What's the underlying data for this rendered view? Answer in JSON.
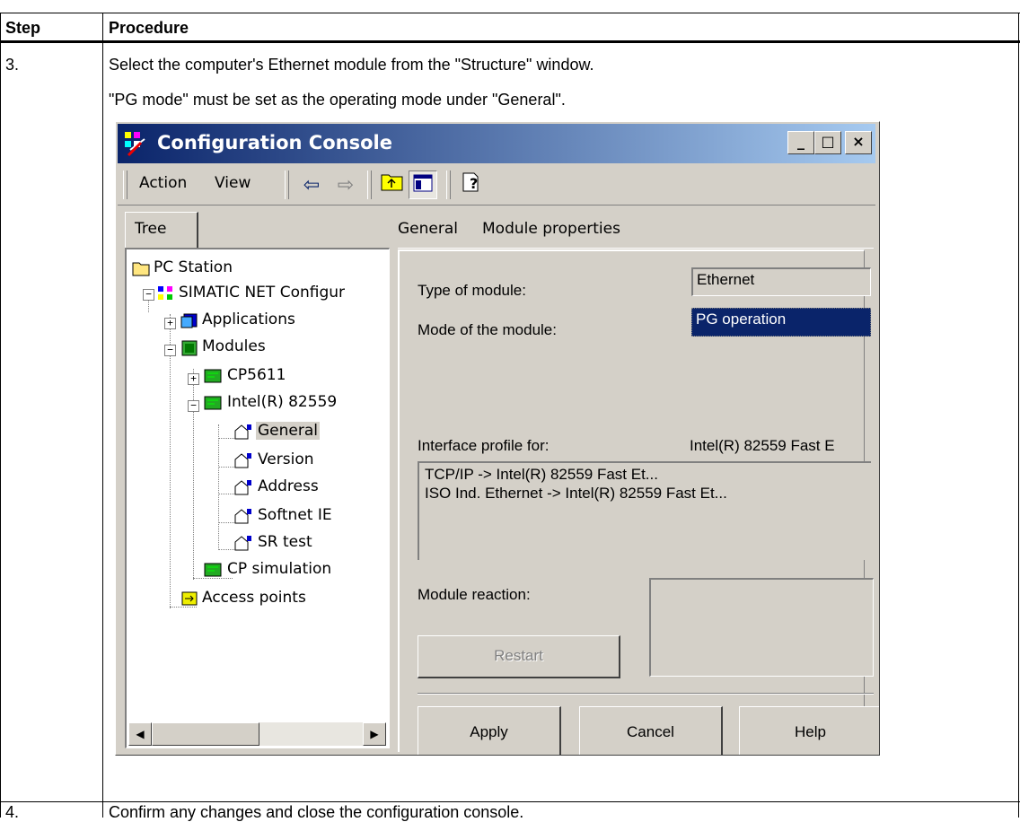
{
  "table": {
    "header_step": "Step",
    "header_procedure": "Procedure",
    "row3_step": "3.",
    "row3_line1": "Select the computer's Ethernet module from the \"Structure\" window.",
    "row3_line2": "\"PG mode\" must be set as the operating mode under \"General\".",
    "row4_step": "4.",
    "row4_text": "Confirm any changes and close the configuration console."
  },
  "window": {
    "title": "Configuration Console",
    "minimize": "_",
    "maximize": "□",
    "close": "×",
    "menu": {
      "action": "Action",
      "view": "View"
    },
    "tree_tab": "Tree",
    "tree": [
      {
        "label": "PC Station",
        "icon": "folder-icon"
      },
      {
        "label": "SIMATIC NET Configur",
        "icon": "network-config-icon"
      },
      {
        "label": "Applications",
        "icon": "applications-icon"
      },
      {
        "label": "Modules",
        "icon": "modules-icon"
      },
      {
        "label": "CP5611",
        "icon": "module-card-icon"
      },
      {
        "label": "Intel(R) 82559",
        "icon": "module-card-icon"
      },
      {
        "label": "General",
        "icon": "properties-icon",
        "selected": true
      },
      {
        "label": "Version",
        "icon": "properties-icon"
      },
      {
        "label": "Address",
        "icon": "properties-icon"
      },
      {
        "label": "Softnet IE",
        "icon": "properties-icon"
      },
      {
        "label": "SR test",
        "icon": "properties-icon"
      },
      {
        "label": "CP simulation",
        "icon": "module-card-icon"
      },
      {
        "label": "Access points",
        "icon": "access-points-icon"
      }
    ],
    "right_tabs": {
      "general": "General",
      "module_properties": "Module properties"
    },
    "form": {
      "type_label": "Type of module:",
      "type_value": "Ethernet",
      "mode_label": "Mode of the module:",
      "mode_value": "PG operation",
      "interface_label": "Interface profile for:",
      "interface_value": "Intel(R) 82559 Fast E",
      "profiles": [
        "TCP/IP -> Intel(R) 82559 Fast Et...",
        "ISO Ind. Ethernet -> Intel(R) 82559 Fast Et..."
      ],
      "reaction_label": "Module reaction:",
      "restart_button": "Restart",
      "apply_button": "Apply",
      "cancel_button": "Cancel",
      "help_button": "Help"
    }
  }
}
